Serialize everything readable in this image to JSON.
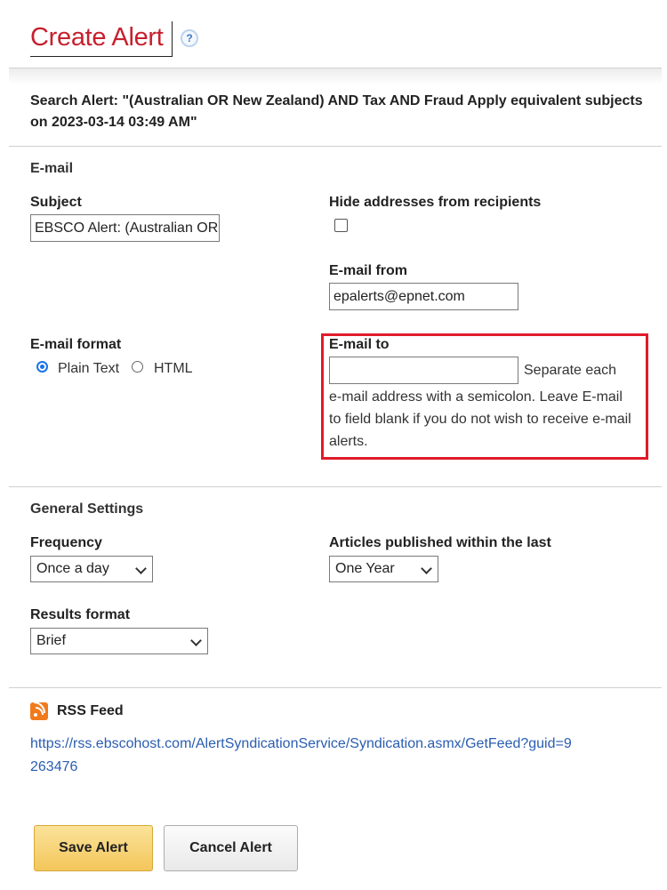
{
  "header": {
    "title": "Create Alert",
    "help_glyph": "?"
  },
  "search_alert": {
    "text": "Search Alert: \"(Australian OR New Zealand) AND Tax AND Fraud Apply equivalent subjects on 2023-03-14 03:49 AM\""
  },
  "email": {
    "section_title": "E-mail",
    "subject": {
      "label": "Subject",
      "value": "EBSCO Alert: (Australian OR New Zealand) AND Tax AND Fraud"
    },
    "hide_addresses": {
      "label": "Hide addresses from recipients",
      "checked": false
    },
    "from": {
      "label": "E-mail from",
      "value": "epalerts@epnet.com"
    },
    "format": {
      "label": "E-mail format",
      "options": [
        "Plain Text",
        "HTML"
      ],
      "selected": "Plain Text"
    },
    "to": {
      "label": "E-mail to",
      "value": "",
      "help_line1": "Separate each",
      "help_rest": "e-mail address with a semicolon. Leave E-mail to field blank if you do not wish to receive e-mail alerts."
    }
  },
  "general": {
    "section_title": "General Settings",
    "frequency": {
      "label": "Frequency",
      "value": "Once a day"
    },
    "published_within": {
      "label": "Articles published within the last",
      "value": "One Year"
    },
    "results_format": {
      "label": "Results format",
      "value": "Brief"
    }
  },
  "rss": {
    "title": "RSS Feed",
    "icon": "rss-icon",
    "url": "https://rss.ebscohost.com/AlertSyndicationService/Syndication.asmx/GetFeed?guid=9263476"
  },
  "buttons": {
    "save": "Save Alert",
    "cancel": "Cancel Alert"
  },
  "colors": {
    "title": "#c6202e",
    "highlight": "#e01b2a",
    "link": "#2a5db0",
    "save_button": "#f3c65a"
  }
}
